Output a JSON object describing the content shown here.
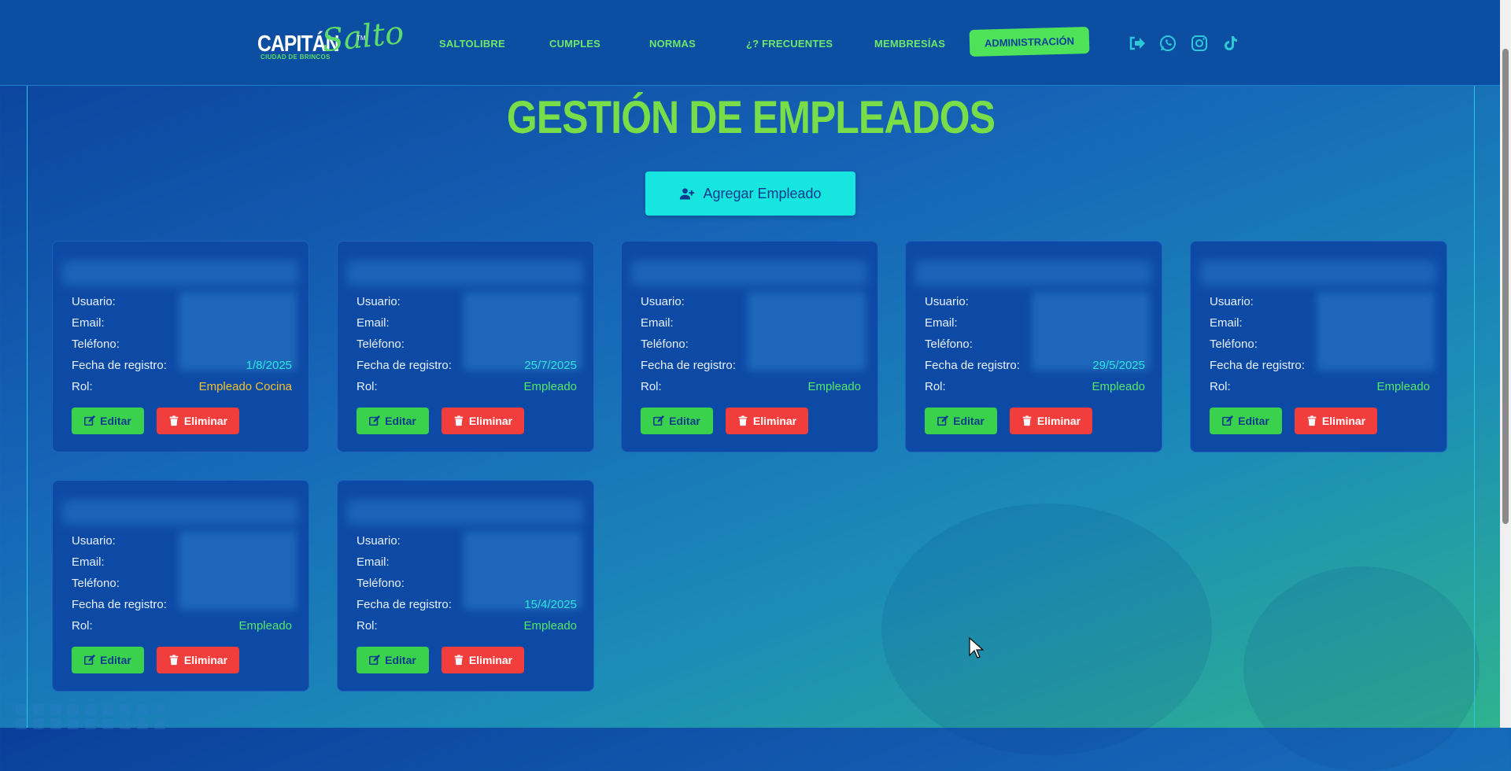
{
  "brand": {
    "name": "CAPITÁN",
    "script": "Salto",
    "tm": "TM",
    "tagline": "CIUDAD DE BRINCOS"
  },
  "nav": {
    "items": [
      "SALTOLIBRE",
      "CUMPLES",
      "NORMAS",
      "¿? FRECUENTES",
      "MEMBRESÍAS"
    ],
    "admin": "ADMINISTRACIÓN",
    "social": [
      "logout-icon",
      "whatsapp-icon",
      "instagram-icon",
      "tiktok-icon"
    ]
  },
  "page": {
    "title": "GESTIÓN DE EMPLEADOS",
    "add_button": "Agregar Empleado"
  },
  "labels": {
    "usuario": "Usuario:",
    "email": "Email:",
    "telefono": "Teléfono:",
    "fecha": "Fecha de registro:",
    "rol": "Rol:",
    "edit": "Editar",
    "delete": "Eliminar"
  },
  "employees": [
    {
      "fecha": "1/8/2025",
      "rol": "Empleado Cocina"
    },
    {
      "fecha": "25/7/2025",
      "rol": "Empleado"
    },
    {
      "fecha": "",
      "rol": "Empleado"
    },
    {
      "fecha": "29/5/2025",
      "rol": "Empleado"
    },
    {
      "fecha": "",
      "rol": "Empleado"
    },
    {
      "fecha": "",
      "rol": "Empleado"
    },
    {
      "fecha": "15/4/2025",
      "rol": "Empleado"
    }
  ],
  "colors": {
    "accent": "#56e86a",
    "teal": "#17e6e0",
    "danger": "#f23d3d",
    "header": "#0c4ea2"
  }
}
